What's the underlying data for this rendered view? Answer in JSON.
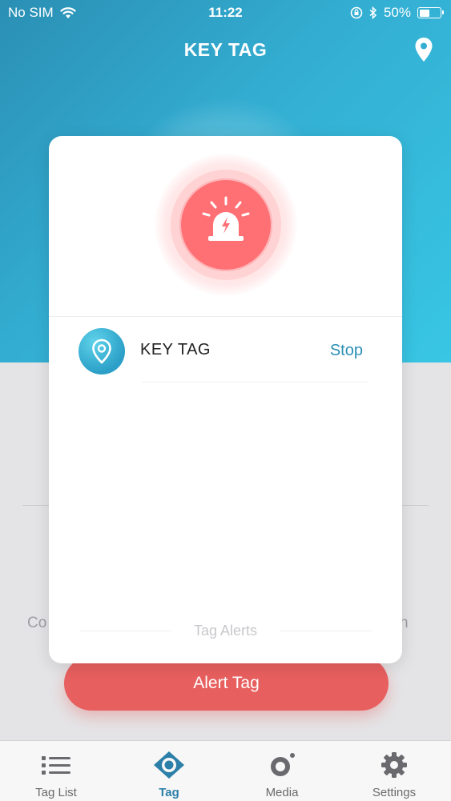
{
  "status_bar": {
    "carrier": "No SIM",
    "time": "11:22",
    "battery": "50%",
    "battery_level": 0.5
  },
  "header": {
    "title": "KEY TAG",
    "location_icon": "location-pin-icon"
  },
  "background": {
    "peek_left": "Co",
    "peek_right": "n",
    "alert_button": "Alert Tag"
  },
  "modal": {
    "siren_icon": "siren-icon",
    "tag": {
      "name": "KEY TAG",
      "action": "Stop"
    },
    "footer_label": "Tag Alerts"
  },
  "tabbar": {
    "items": [
      {
        "label": "Tag List",
        "icon": "list-icon"
      },
      {
        "label": "Tag",
        "icon": "tag-eye-icon",
        "active": true
      },
      {
        "label": "Media",
        "icon": "media-icon"
      },
      {
        "label": "Settings",
        "icon": "gear-icon"
      }
    ]
  },
  "colors": {
    "header_start": "#2b8fb4",
    "header_end": "#38c6e4",
    "alert_red": "#e85f5f",
    "accent_blue": "#2b90b5"
  }
}
